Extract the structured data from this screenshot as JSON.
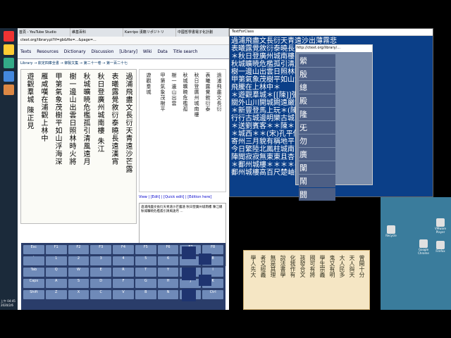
{
  "browser": {
    "tabs": [
      "首頁 - YouTube Studio",
      "維基百科",
      "Kanripo 漢籍リポジトリ",
      "中國哲學書電子化計劃"
    ],
    "url": "ctext.org/library.pl?if=gb&file=...&page=...",
    "nav": [
      "Texts",
      "Resources",
      "Dictionary",
      "Discussion",
      "[Library]",
      "Wiki",
      "Data",
      "Wiki",
      "Title search"
    ],
    "breadcrumb": "Library → 欽定四庫全書 → 御製文集 → 第二十一卷 → 第一百二十七",
    "scan_columns": [
      "過浦飛盡文長衍天青遠沙芒露",
      "表曦露覺敘衍泰曉長遠漢宵",
      "秋日登廣州城南樓  朱江",
      "秋城曠暁危檻孤引清風遠月",
      "樹一邊山出雲日照林時火將",
      "甲第氣象茂樹平如山浮海深",
      "雁咸嘆在浦觀上林中",
      "遊觀羣城  陳正見"
    ],
    "text_columns": [
      "過浦飛盡文長衍",
      "表曦露覺敘衍泰",
      "秋日登廣州城南樓",
      "秋城曠暁危檻孤",
      "樹一邊山出雲",
      "甲第氣象茂樹平",
      "遊觀羣城"
    ],
    "bottom_links": "View | [Edit] | [Quick edit] | [Edition here]",
    "edit_text": "過浦飛盡文長衍天青遠沙芒露遠 秋日登廣州城南樓 陳江總 秋城曠暁危檻孤引清風遠月 ...",
    "keyboard_rows": [
      [
        "Esc",
        "F1",
        "F2",
        "F3",
        "F4",
        "F5",
        "F6",
        "F7",
        "F8"
      ],
      [
        "`",
        "1",
        "2",
        "3",
        "4",
        "5",
        "6",
        "7",
        "8"
      ],
      [
        "Tab",
        "Q",
        "W",
        "E",
        "R",
        "T",
        "Y",
        "U",
        "I"
      ],
      [
        "Caps",
        "A",
        "S",
        "D",
        "F",
        "G",
        "H",
        "J",
        "K"
      ],
      [
        "Shift",
        "Z",
        "X",
        "C",
        "V",
        "B",
        "N",
        "M",
        "Ctrl"
      ]
    ]
  },
  "editor": {
    "title": "TextForClass",
    "lines": [
      "過浦飛盡文長衍天青遠沙出薄霧悲",
      "表曦露覺敘衍泰曉長遠漢宵",
      "＊秋日登廣州城南樓＊(陳)江  總",
      "秋城曠暁危檻孤引清風遠月飛",
      "樹一邊山出雲日照林時火將",
      "甲第氣象茂樹平如山浮海深",
      "飛騰在上林中＊",
      "＊遊觀羣城＊[[陳]]張正見",
      "關外山川開城闕遠嚴霧",
      "＊新豐登馬上玩＊(陳)陳朝",
      "行行古城邊明樂古城",
      "＊送劉賓客＊＊陳＊",
      "＊城西＊＊(宋)孔平仲",
      "寄州三月貌有稱地平",
      "今日繁陸北鳳柱城南",
      "陣聞寂寂無東東且杏",
      "＊鄱州城樓＊＊＊＊(宋)陳與義",
      "鄱州城樓高百尺楚岫齊雲"
    ],
    "popup_title": "http://ctext.org/library/...",
    "popup_chars": [
      "縈",
      "殷",
      "總",
      "殿",
      "隆",
      "旡",
      "勿",
      "廣",
      "闌",
      "鬧",
      "闘"
    ]
  },
  "panel": {
    "columns": [
      "曾開十分",
      "天人與天",
      "大人民多",
      "鬼又有明",
      "學生宗義",
      "國可有將",
      "孩發合文",
      "化我作有",
      "說法書學",
      "無是其理",
      "者又經義",
      "學人先大"
    ]
  },
  "desktop": {
    "icons": [
      "VMware Player",
      "Google Chrome",
      "Firefox",
      "Recycle"
    ]
  },
  "taskbar": {
    "clock": "上午 04:45",
    "date": "2020/2/6"
  },
  "colors": {
    "editor_bg": "#0b3f88",
    "keyboard_bg": "#2a3d6a",
    "panel_bg": "#f5e6c4"
  }
}
